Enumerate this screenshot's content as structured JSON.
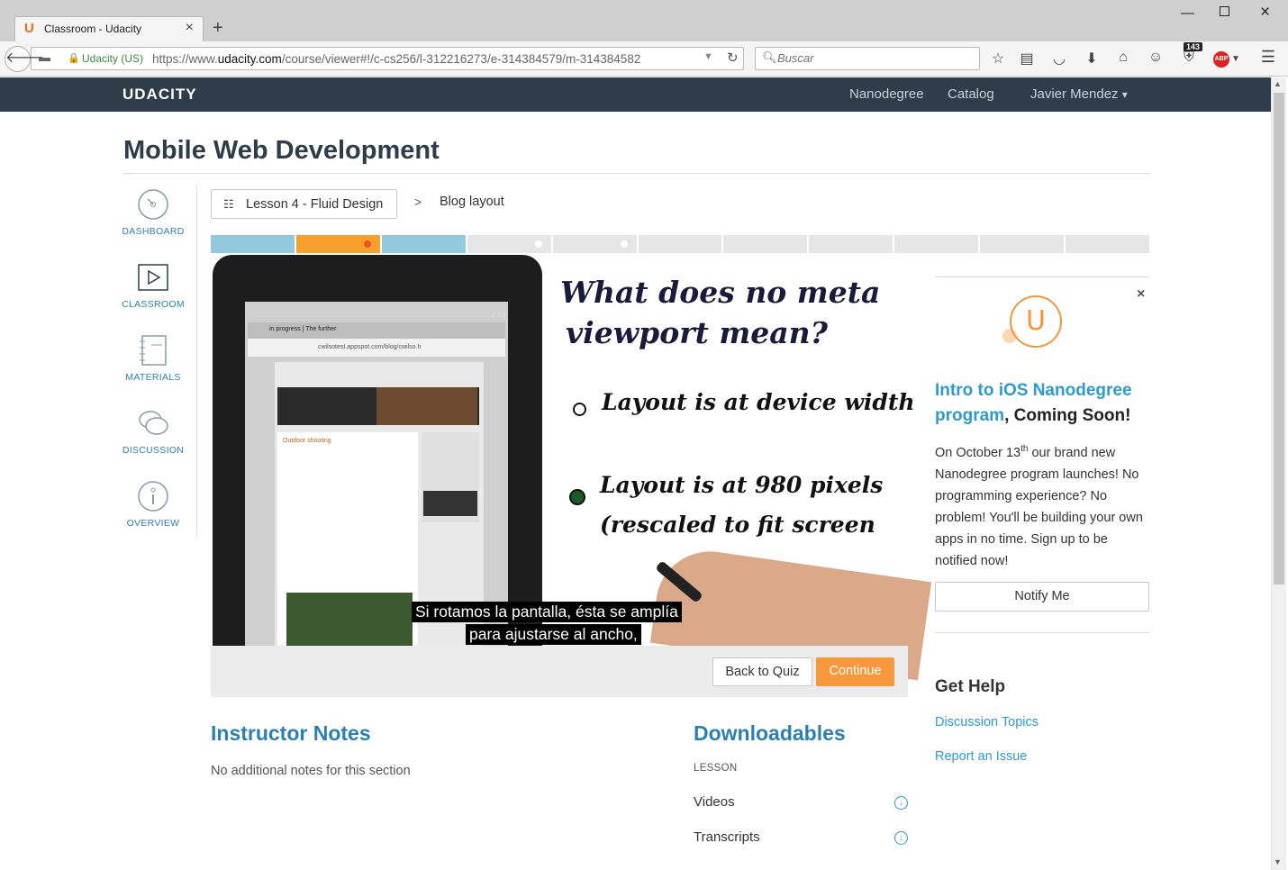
{
  "browser": {
    "tab_title": "Classroom - Udacity",
    "tab_favicon": "U",
    "new_tab": "+",
    "url_org": "Udacity (US)",
    "url_prefix": "https://www.",
    "url_domain": "udacity.com",
    "url_path": "/course/viewer#!/c-cs256/l-312216273/e-314384579/m-314384582",
    "search_placeholder": "Buscar",
    "badge_count": "143",
    "abp_label": "ABP"
  },
  "site": {
    "logo": "UDACITY",
    "nav": [
      "Nanodegree",
      "Catalog",
      "Javier Mendez"
    ],
    "dropdown_caret": "▾"
  },
  "page_title": "Mobile Web Development",
  "sidebar": {
    "items": [
      {
        "label": "DASHBOARD",
        "icon": "dashboard-gauge-icon"
      },
      {
        "label": "CLASSROOM",
        "icon": "play-icon"
      },
      {
        "label": "MATERIALS",
        "icon": "notebook-icon"
      },
      {
        "label": "DISCUSSION",
        "icon": "chat-bubbles-icon"
      },
      {
        "label": "OVERVIEW",
        "icon": "info-icon"
      }
    ]
  },
  "breadcrumb": {
    "lesson": "Lesson 4 - Fluid Design",
    "separator": ">",
    "current": "Blog layout"
  },
  "progress": {
    "segments": [
      {
        "state": "complete"
      },
      {
        "state": "current"
      },
      {
        "state": "complete"
      },
      {
        "state": "incomplete",
        "dot": true
      },
      {
        "state": "incomplete",
        "dot": true
      },
      {
        "state": "incomplete"
      },
      {
        "state": "incomplete"
      },
      {
        "state": "incomplete"
      },
      {
        "state": "incomplete"
      },
      {
        "state": "incomplete"
      },
      {
        "state": "incomplete"
      }
    ],
    "colors": {
      "complete": "#93c9dc",
      "current": "#f6a02e",
      "incomplete": "#e6e6e6",
      "current_dot": "#e8581c",
      "dot": "#ffffff"
    }
  },
  "video": {
    "whiteboard_lines": [
      "What does no meta",
      "viewport mean?",
      "Layout is at device width",
      "Layout is at 980 pixels",
      "(rescaled to fit screen"
    ],
    "subtitle_lines": [
      "Si rotamos la pantalla, ésta se amplía",
      "para ajustarse al ancho,"
    ],
    "tablet_tab": "in progress | The further",
    "tablet_url": "cwilsotest.appspot.com/blog/cwilso.h",
    "tablet_time": "2:53",
    "tablet_heading": "Outdoor shooting"
  },
  "controls": {
    "back_to_quiz": "Back to Quiz",
    "continue": "Continue"
  },
  "instructor_notes": {
    "title": "Instructor Notes",
    "body": "No additional notes for this section"
  },
  "downloadables": {
    "title": "Downloadables",
    "section_label": "LESSON",
    "items": [
      "Videos",
      "Transcripts"
    ]
  },
  "promo": {
    "close": "×",
    "logo_letter": "U",
    "link_text": "Intro to iOS Nanodegree program",
    "title_suffix": ", Coming Soon!",
    "body_pre": "On October 13",
    "body_sup": "th",
    "body_post": " our brand new Nanodegree program launches! No programming experience? No problem! You'll be building your own apps in no time. Sign up to be notified now!",
    "button": "Notify Me"
  },
  "help": {
    "title": "Get Help",
    "links": [
      "Discussion Topics",
      "Report an Issue"
    ]
  }
}
